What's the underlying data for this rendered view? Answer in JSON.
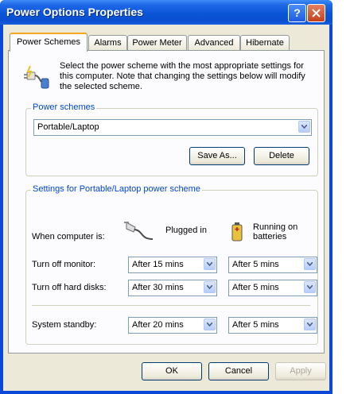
{
  "window": {
    "title": "Power Options Properties",
    "help_label": "?"
  },
  "tabs": [
    {
      "label": "Power Schemes",
      "active": true
    },
    {
      "label": "Alarms"
    },
    {
      "label": "Power Meter"
    },
    {
      "label": "Advanced"
    },
    {
      "label": "Hibernate"
    }
  ],
  "intro": {
    "text": "Select the power scheme with the most appropriate settings for this computer. Note that changing the settings below will modify the selected scheme."
  },
  "schemes": {
    "group_label": "Power schemes",
    "selected": "Portable/Laptop",
    "save_as_label": "Save As...",
    "delete_label": "Delete"
  },
  "settings": {
    "group_label": "Settings for Portable/Laptop power scheme",
    "when_label": "When computer is:",
    "plugged_label": "Plugged in",
    "batteries_label": "Running on batteries",
    "rows": [
      {
        "label": "Turn off monitor:",
        "plugged": "After 15 mins",
        "battery": "After 5 mins"
      },
      {
        "label": "Turn off hard disks:",
        "plugged": "After 30 mins",
        "battery": "After 5 mins"
      },
      {
        "label": "System standby:",
        "plugged": "After 20 mins",
        "battery": "After 5 mins"
      }
    ]
  },
  "footer": {
    "ok_label": "OK",
    "cancel_label": "Cancel",
    "apply_label": "Apply"
  }
}
